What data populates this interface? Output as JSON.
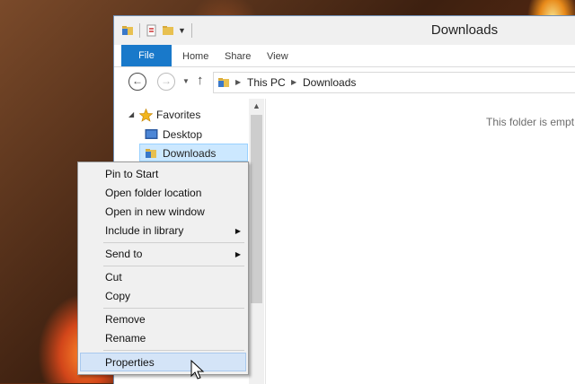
{
  "window": {
    "title": "Downloads"
  },
  "ribbon": {
    "tabs": [
      "File",
      "Home",
      "Share",
      "View"
    ]
  },
  "address": {
    "breadcrumbs": [
      "This PC",
      "Downloads"
    ]
  },
  "nav_pane": {
    "favorites_label": "Favorites",
    "items": [
      "Desktop",
      "Downloads"
    ]
  },
  "content": {
    "empty_message": "This folder is empt"
  },
  "context_menu": {
    "items": [
      {
        "label": "Pin to Start"
      },
      {
        "label": "Open folder location"
      },
      {
        "label": "Open in new window"
      },
      {
        "label": "Include in library",
        "submenu": true
      },
      {
        "label": "Send to",
        "submenu": true
      },
      {
        "label": "Cut"
      },
      {
        "label": "Copy"
      },
      {
        "label": "Remove"
      },
      {
        "label": "Rename"
      },
      {
        "label": "Properties",
        "highlighted": true
      }
    ]
  },
  "colors": {
    "accent": "#1979ca",
    "selection": "#cce8ff",
    "menu_highlight": "#d4e4f7"
  },
  "icons": [
    "folder-icon",
    "properties-icon",
    "back-icon",
    "forward-icon",
    "up-icon",
    "star-icon",
    "desktop-icon",
    "submenu-arrow-icon",
    "cursor-icon"
  ]
}
